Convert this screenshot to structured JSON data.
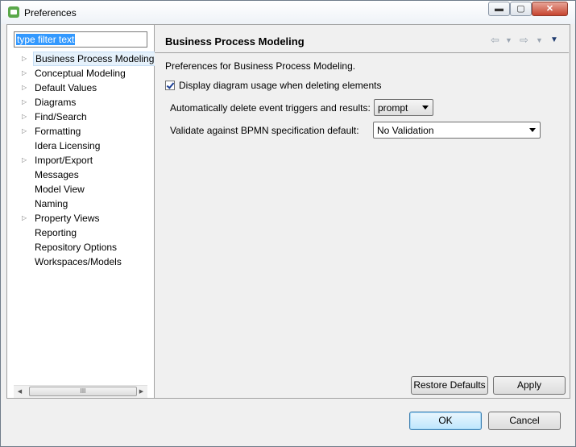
{
  "window": {
    "title": "Preferences",
    "minimize_glyph": "▬",
    "maximize_glyph": "▢",
    "close_glyph": "✕"
  },
  "sidebar": {
    "filter_placeholder": "type filter text",
    "items": [
      {
        "label": "Business Process Modeling",
        "expandable": true
      },
      {
        "label": "Conceptual Modeling",
        "expandable": true
      },
      {
        "label": "Default Values",
        "expandable": true
      },
      {
        "label": "Diagrams",
        "expandable": true
      },
      {
        "label": "Find/Search",
        "expandable": true
      },
      {
        "label": "Formatting",
        "expandable": true
      },
      {
        "label": "Idera Licensing",
        "expandable": false
      },
      {
        "label": "Import/Export",
        "expandable": true
      },
      {
        "label": "Messages",
        "expandable": false
      },
      {
        "label": "Model View",
        "expandable": false
      },
      {
        "label": "Naming",
        "expandable": false
      },
      {
        "label": "Property Views",
        "expandable": true
      },
      {
        "label": "Reporting",
        "expandable": false
      },
      {
        "label": "Repository Options",
        "expandable": false
      },
      {
        "label": "Workspaces/Models",
        "expandable": false
      }
    ],
    "scroll_thumb_glyph": "III"
  },
  "page": {
    "title": "Business Process Modeling",
    "description": "Preferences for Business Process Modeling.",
    "checkbox_label": "Display diagram usage when deleting elements",
    "checkbox_checked": true,
    "auto_delete_label": "Automatically delete event triggers and results:",
    "auto_delete_value": "prompt",
    "validate_label": "Validate against BPMN specification default:",
    "validate_value": "No Validation",
    "restore_defaults_label": "Restore Defaults",
    "apply_label": "Apply"
  },
  "footer": {
    "ok_label": "OK",
    "cancel_label": "Cancel"
  },
  "icons": {
    "back": "back-arrow-icon",
    "forward": "forward-arrow-icon",
    "menu": "view-menu-icon"
  }
}
